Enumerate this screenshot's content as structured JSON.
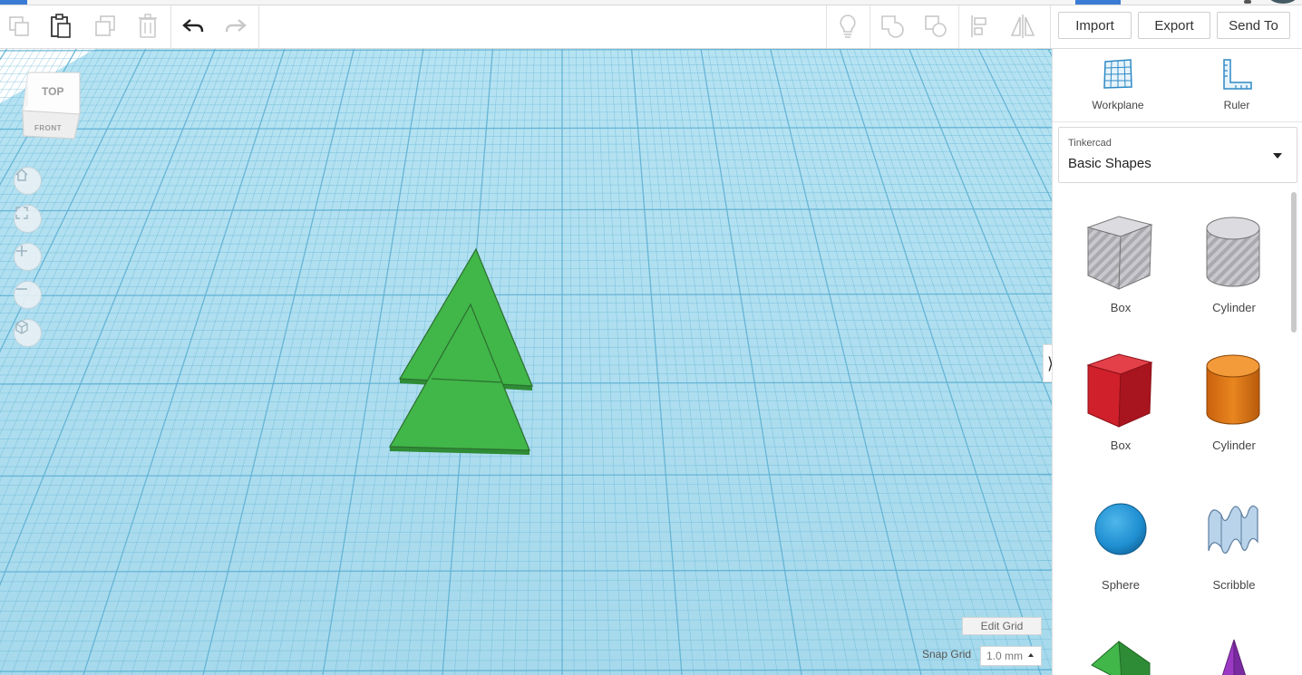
{
  "toolbar": {
    "copy_icon": "copy-icon",
    "paste_icon": "paste-icon",
    "duplicate_icon": "duplicate-icon",
    "delete_icon": "trash-icon",
    "undo_icon": "undo-icon",
    "redo_icon": "redo-icon",
    "right_icons": [
      "lightbulb-icon",
      "group-icon",
      "ungroup-icon",
      "align-icon",
      "mirror-icon"
    ],
    "import_label": "Import",
    "export_label": "Export",
    "send_to_label": "Send To"
  },
  "viewcube": {
    "top_label": "TOP",
    "front_label": "FRONT"
  },
  "nav": [
    "home-icon",
    "fit-view-icon",
    "zoom-in-icon",
    "zoom-out-icon",
    "perspective-icon"
  ],
  "grid": {
    "edit_label": "Edit Grid",
    "snap_label": "Snap Grid",
    "snap_value": "1.0 mm"
  },
  "panel": {
    "workplane_label": "Workplane",
    "ruler_label": "Ruler",
    "library_category": "Tinkercad",
    "library_name": "Basic Shapes",
    "shapes": [
      {
        "label": "Box",
        "icon": "box-hole-icon"
      },
      {
        "label": "Cylinder",
        "icon": "cylinder-hole-icon"
      },
      {
        "label": "Box",
        "icon": "box-icon"
      },
      {
        "label": "Cylinder",
        "icon": "cylinder-icon"
      },
      {
        "label": "Sphere",
        "icon": "sphere-icon"
      },
      {
        "label": "Scribble",
        "icon": "scribble-icon"
      }
    ]
  },
  "colors": {
    "workplane": "#a9dcef",
    "grid_line": "#5fb0d3",
    "shape_green": "#41b649",
    "box_red": "#d0202b",
    "cylinder_orange": "#e57c1b",
    "sphere_blue": "#1f8fd1"
  }
}
